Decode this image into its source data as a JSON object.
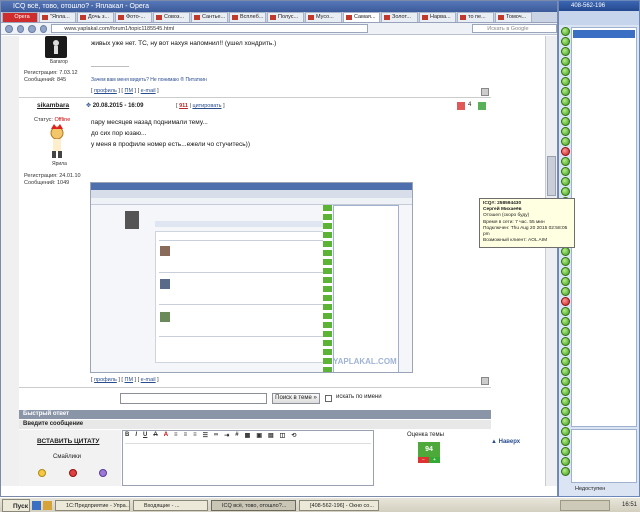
{
  "window": {
    "title": "ICQ всё, тово, отошло? - Яплакал - Opera",
    "opera_label": "Opera",
    "tabs": [
      "\"Япла...",
      "Дочь з...",
      "Фото-...",
      "Совоз...",
      "Сантье...",
      "Всплеб...",
      "Полус...",
      "Мусо...",
      "Самая...",
      "Золот...",
      "Нарва...",
      "то пе...",
      "Томоч..."
    ],
    "url": "www.yaplakal.com/forum1/topic1185545.html",
    "search_placeholder": "Искать в Google"
  },
  "post1": {
    "text": "живых уже нет. ТС, ну вот нахуя напомнил!! (ушел хондрить.)",
    "user_caption": "Багагор",
    "reg": "Регистрация: 7.03.12",
    "msgs": "Сообщений: 845",
    "separator": "-------------------",
    "signature": "Зачем вам меня видеть? Не понимаю ® Питаткин",
    "links": [
      "профиль",
      "ПМ",
      "e-mail"
    ]
  },
  "post2": {
    "username": "sikambara",
    "status_label": "Статус:",
    "status_value": "Offline",
    "user_caption": "Ярила",
    "date": "20.08.2015 - 16:09",
    "post_number": "911",
    "quote_label": "цитировать",
    "rating": "4",
    "lines": [
      "пару месяцев назад поднимали тему...",
      "до сих пор юзаю...",
      "у меня в профиле номер есть...ежели чо стучитесь))"
    ],
    "reg": "Регистрация: 24.01.10",
    "msgs": "Сообщений: 1049",
    "links": [
      "профиль",
      "ПМ",
      "e-mail"
    ],
    "watermark": "YAPLAKAL.COM"
  },
  "search_bar": {
    "button": "Поиск в теме »",
    "checkbox_label": "искать по имени"
  },
  "quick_reply": {
    "header": "Быстрый ответ",
    "subheader": "Введите сообщение",
    "insert_quote": "ВСТАВИТЬ ЦИТАТУ",
    "smilies": "Смайлики",
    "rating_label": "Оценка темы",
    "rating_value": "94",
    "up": "Наверх"
  },
  "icq": {
    "title": "408-562-196",
    "tooltip": {
      "line1": "ICQ#: 258594430",
      "line2": "Сергей Михаеёв",
      "line3": "Отошел (скоро буду)",
      "line4": "Время в сети: 7 час. 55 мин",
      "line5": "Подключен: Thu Aug 20 2015 02:58:05 pm",
      "line6": "Возможный клиент: AOL AIM"
    },
    "bottom_label": "Недоступен"
  },
  "taskbar": {
    "start": "Пуск",
    "buttons": [
      "1С:Предприятие - Упра...",
      "Входящие - ...",
      "ICQ всё, тово, отошло?...",
      "[408-562-196] - Окно со..."
    ],
    "clock": "16:51"
  }
}
